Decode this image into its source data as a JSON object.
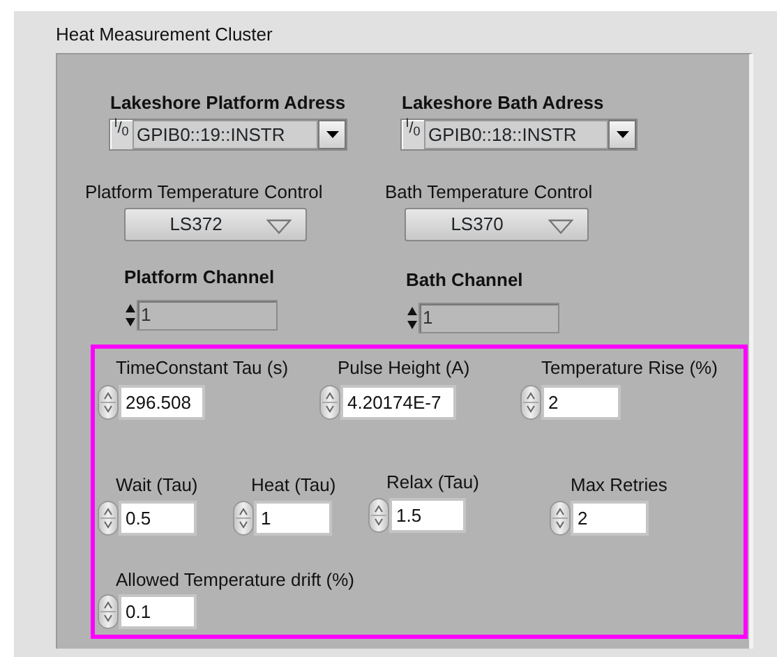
{
  "cluster": {
    "title": "Heat Measurement Cluster",
    "controls": [
      {
        "kind": "visa",
        "label": "Lakeshore Platform Adress",
        "label_bold": true,
        "prefix": "$^{I}$/$_{0}$",
        "value": "GPIB0::19::INSTR"
      },
      {
        "kind": "visa",
        "label": "Lakeshore Bath Adress",
        "label_bold": true,
        "prefix": "$^{I}$/$_{0}$",
        "value": "GPIB0::18::INSTR"
      },
      {
        "kind": "ring",
        "label": "Platform Temperature Control",
        "label_bold": false,
        "value": "LS372"
      },
      {
        "kind": "ring",
        "label": "Bath Temperature Control",
        "label_bold": false,
        "value": "LS370"
      },
      {
        "kind": "numeric",
        "label": "Platform Channel",
        "label_bold": true,
        "value": "1",
        "disabled": true
      },
      {
        "kind": "numeric",
        "label": "Bath Channel",
        "label_bold": true,
        "value": "1",
        "disabled": true
      }
    ],
    "highlighted_controls": [
      {
        "kind": "numeric",
        "label": "TimeConstant Tau (s)",
        "label_bold": false,
        "value": "296.508",
        "disabled": false
      },
      {
        "kind": "numeric",
        "label": "Pulse Height (A)",
        "label_bold": false,
        "value": "4.20174E-7",
        "disabled": false
      },
      {
        "kind": "numeric",
        "label": "Temperature Rise (%)",
        "label_bold": false,
        "value": "2",
        "disabled": false
      },
      {
        "kind": "numeric",
        "label": "Wait (Tau)",
        "label_bold": false,
        "value": "0.5",
        "disabled": false
      },
      {
        "kind": "numeric",
        "label": "Heat (Tau)",
        "label_bold": false,
        "value": "1",
        "disabled": false
      },
      {
        "kind": "numeric",
        "label": "Relax (Tau)",
        "label_bold": false,
        "value": "1.5",
        "disabled": false
      },
      {
        "kind": "numeric",
        "label": "Max Retries",
        "label_bold": false,
        "value": "2",
        "disabled": false
      },
      {
        "kind": "numeric",
        "label": "Allowed Temperature drift (%)",
        "label_bold": false,
        "value": "0.1",
        "disabled": false
      }
    ]
  }
}
